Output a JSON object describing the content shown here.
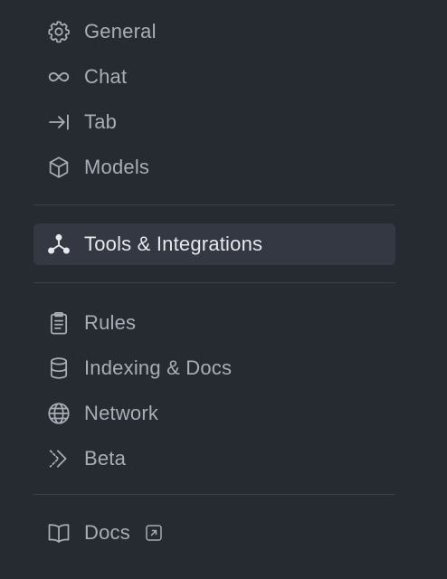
{
  "sidebar": {
    "items": [
      {
        "label": "General",
        "icon": "gear-icon"
      },
      {
        "label": "Chat",
        "icon": "infinity-icon"
      },
      {
        "label": "Tab",
        "icon": "tab-arrow-icon"
      },
      {
        "label": "Models",
        "icon": "cube-icon"
      },
      {
        "label": "Tools & Integrations",
        "icon": "integrations-icon",
        "active": true
      },
      {
        "label": "Rules",
        "icon": "clipboard-icon"
      },
      {
        "label": "Indexing & Docs",
        "icon": "database-icon"
      },
      {
        "label": "Network",
        "icon": "globe-icon"
      },
      {
        "label": "Beta",
        "icon": "chevrons-right-icon"
      },
      {
        "label": "Docs",
        "icon": "book-icon",
        "external_icon": "external-link-icon"
      }
    ]
  },
  "colors": {
    "background": "#262a31",
    "active_background": "#343842",
    "text": "#a8adb6",
    "active_text": "#e6e8ec",
    "divider": "#3a3f48"
  }
}
